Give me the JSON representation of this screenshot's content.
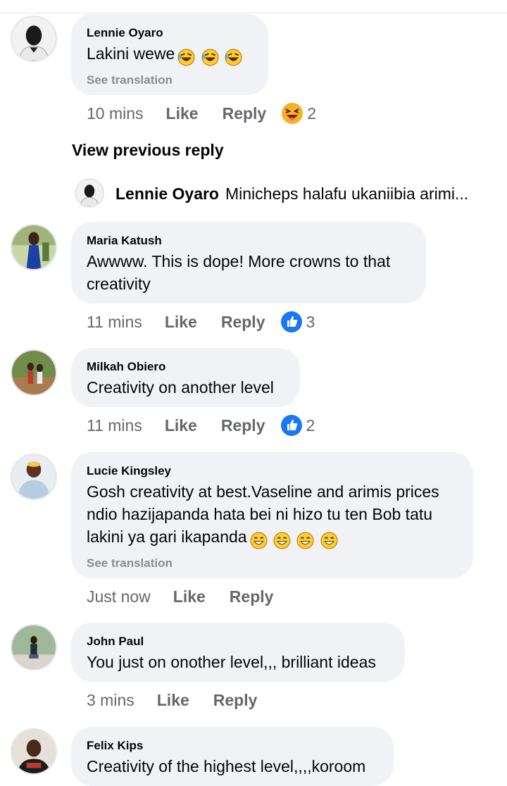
{
  "comments": [
    {
      "author": "Lennie Oyaro",
      "text": "Lakini wewe",
      "emoji": "🤣🤣🤣",
      "see_translation": "See translation",
      "time": "10 mins",
      "like": "Like",
      "reply": "Reply",
      "reaction_icon": "laughing-squint-icon",
      "reaction_count": "2"
    },
    {
      "author": "Maria Katush",
      "text": "Awwww. This is dope! More crowns to that creativity",
      "time": "11 mins",
      "like": "Like",
      "reply": "Reply",
      "reaction_icon": "thumbs-up-icon",
      "reaction_count": "3"
    },
    {
      "author": "Milkah Obiero",
      "text": "Creativity on another level",
      "time": "11 mins",
      "like": "Like",
      "reply": "Reply",
      "reaction_icon": "thumbs-up-icon",
      "reaction_count": "2"
    },
    {
      "author": "Lucie Kingsley",
      "text": "Gosh creativity at best.Vaseline and arimis prices ndio hazijapanda hata bei ni hizo tu ten Bob tatu lakini ya gari ikapanda",
      "emoji": "😄😄😄😄",
      "see_translation": "See translation",
      "time": "Just now",
      "like": "Like",
      "reply": "Reply"
    },
    {
      "author": "John Paul",
      "text": "You just on onother level,,, brilliant ideas",
      "time": "3 mins",
      "like": "Like",
      "reply": "Reply"
    },
    {
      "author": "Felix Kips",
      "text": "Creativity of the highest level,,,,koroom"
    }
  ],
  "view_previous_reply": "View previous reply",
  "reply_preview": {
    "author": "Lennie Oyaro",
    "text": "Minicheps halafu ukaniibia arimi..."
  },
  "colors": {
    "bubble": "#f0f2f5",
    "meta": "#65676b",
    "translation": "#8a8d91",
    "like_blue": "#1877f2"
  }
}
